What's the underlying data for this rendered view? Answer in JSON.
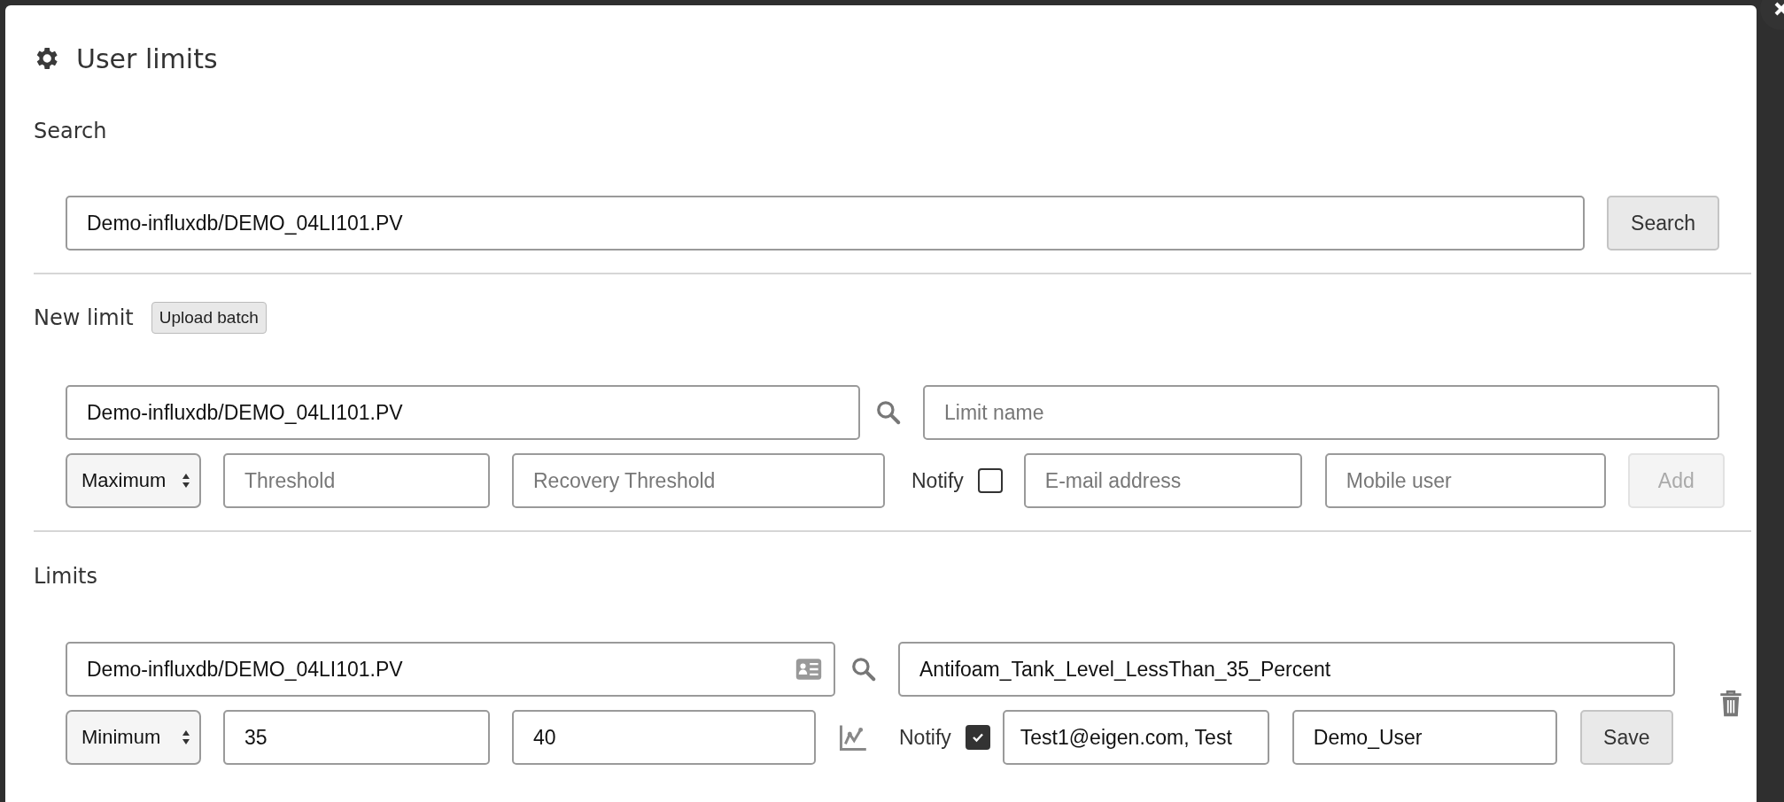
{
  "dialog": {
    "title": "User limits"
  },
  "search": {
    "heading": "Search",
    "tag": {
      "value": "Demo-influxdb/DEMO_04LI101.PV"
    },
    "button": "Search"
  },
  "new_limit": {
    "heading": "New limit",
    "upload_button": "Upload batch",
    "tag": {
      "value": "Demo-influxdb/DEMO_04LI101.PV"
    },
    "limit_name": {
      "placeholder": "Limit name"
    },
    "type": "Maximum",
    "threshold": {
      "placeholder": "Threshold"
    },
    "recovery_threshold": {
      "placeholder": "Recovery Threshold"
    },
    "notify": {
      "label": "Notify",
      "checked": false
    },
    "email": {
      "placeholder": "E-mail address"
    },
    "mobile_user": {
      "placeholder": "Mobile user"
    },
    "add_button": {
      "label": "Add",
      "disabled": true
    }
  },
  "limits": {
    "heading": "Limits",
    "items": [
      {
        "tag": "Demo-influxdb/DEMO_04LI101.PV",
        "name": "Antifoam_Tank_Level_LessThan_35_Percent",
        "type": "Minimum",
        "threshold": "35",
        "recovery_threshold": "40",
        "notify_label": "Notify",
        "notify": true,
        "email": "Test1@eigen.com, Test",
        "mobile_user": "Demo_User",
        "save_button": "Save"
      }
    ]
  }
}
